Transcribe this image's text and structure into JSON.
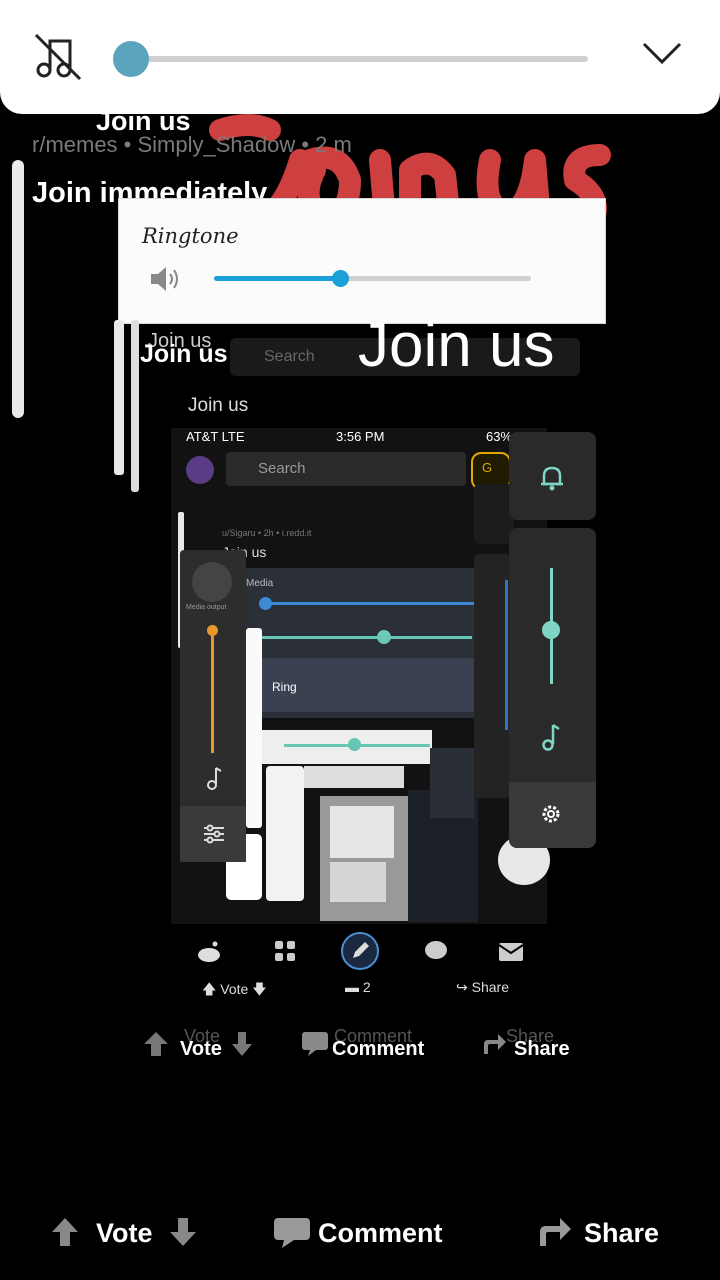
{
  "volume_panel": {
    "level": 0.04,
    "mute_icon": "music-off-icon",
    "collapse_icon": "chevron-down-icon"
  },
  "post": {
    "title_overlay": "Join us",
    "meta": "r/memes • Simply_Shadow • 2 m",
    "title": "Join immediately",
    "scribble_text": "Join us"
  },
  "ringtone": {
    "label": "Ringtone",
    "level": 0.4
  },
  "nested": {
    "join_big": "Join us",
    "join_mid": "Join us",
    "join_mid2": "Join us",
    "search_placeholder": "Search",
    "join_small": "Join us",
    "carrier": "AT&T LTE",
    "time": "3:56 PM",
    "battery": "63%",
    "search_placeholder2": "Search",
    "coin_label": "G",
    "sub_meta": "u/Sigaru • 2h • i.redd.it",
    "join_tiny": "Join us",
    "media_label": "Media",
    "media_output": "Media output",
    "ring_label": "Ring",
    "inner_actions": {
      "vote": "Vote",
      "comments": "2",
      "share": "Share"
    }
  },
  "mid_actions": {
    "vote": "Vote",
    "comment": "Comment",
    "share": "Share",
    "ghost_vote": "Vote",
    "ghost_comment": "Comment",
    "ghost_share": "Share"
  },
  "bottom_actions": {
    "vote": "Vote",
    "comment": "Comment",
    "share": "Share"
  },
  "colors": {
    "accent": "#5aa5bd",
    "ring_accent": "#1ba0d8",
    "scribble": "#e04545",
    "teal": "#7fd6c6",
    "orange": "#e8972b"
  }
}
